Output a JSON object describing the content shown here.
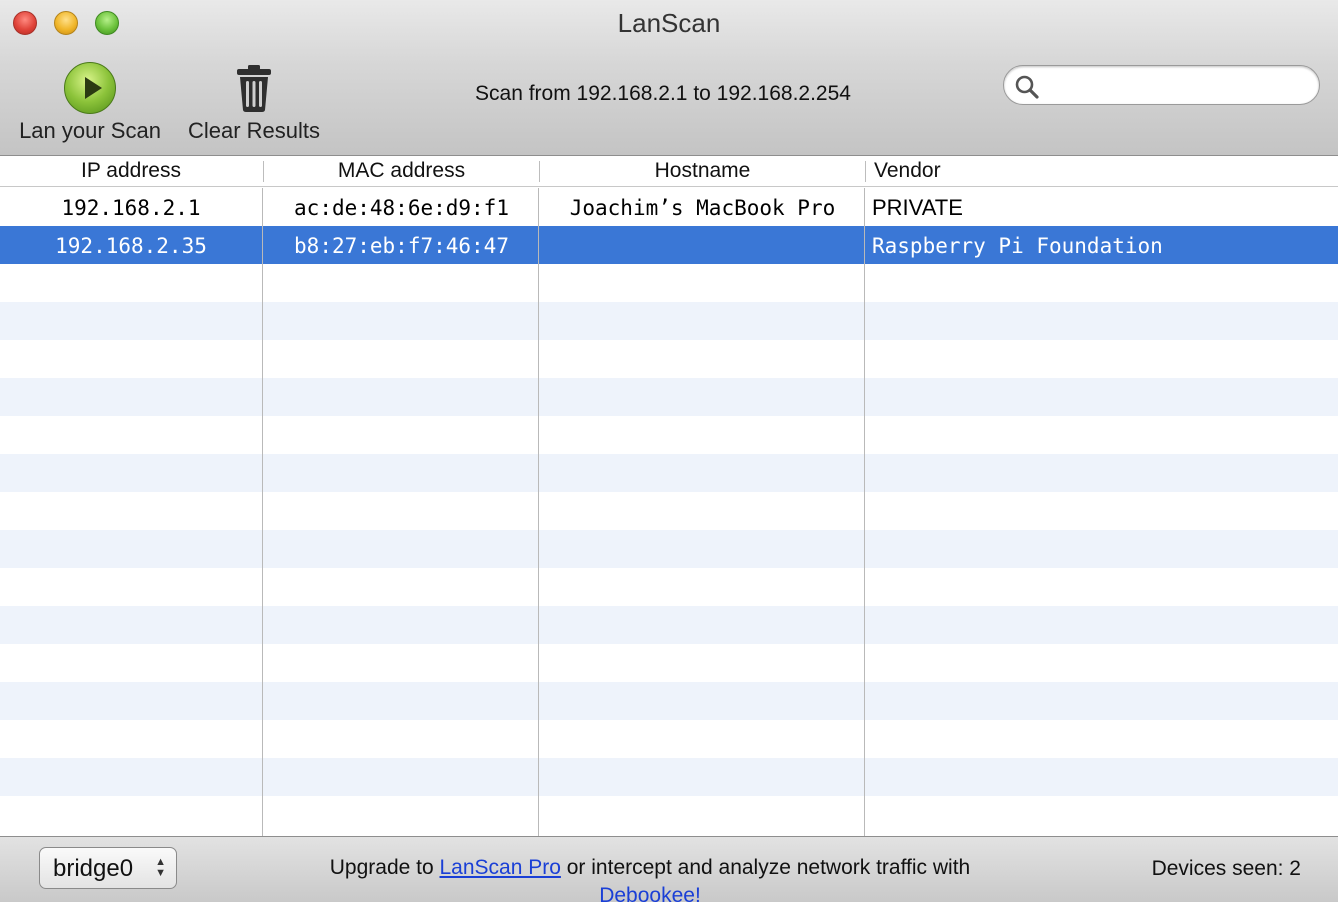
{
  "window": {
    "title": "LanScan"
  },
  "toolbar": {
    "scan_label": "Lan your Scan",
    "clear_label": "Clear Results",
    "scan_range": "Scan from 192.168.2.1 to 192.168.2.254",
    "search": {
      "value": "",
      "placeholder": ""
    }
  },
  "table": {
    "columns": [
      "IP address",
      "MAC address",
      "Hostname",
      "Vendor"
    ],
    "rows": [
      {
        "ip": "192.168.2.1",
        "mac": "ac:de:48:6e:d9:f1",
        "hostname": "Joachim’s MacBook Pro",
        "vendor": "PRIVATE",
        "selected": false
      },
      {
        "ip": "192.168.2.35",
        "mac": "b8:27:eb:f7:46:47",
        "hostname": "",
        "vendor": "Raspberry Pi Foundation",
        "selected": true
      }
    ]
  },
  "footer": {
    "interface": "bridge0",
    "promo_prefix": "Upgrade to ",
    "promo_link": "LanScan Pro",
    "promo_middle": " or intercept and analyze network traffic with",
    "promo_link2": "Debookee!",
    "devices_seen": "Devices seen: 2"
  },
  "colors": {
    "selection": "#3a77d6",
    "link": "#1a3fd6",
    "alt_row": "#eef3fb"
  },
  "icons": {
    "scan": "play-icon",
    "clear": "trash-icon",
    "search": "search-icon"
  }
}
